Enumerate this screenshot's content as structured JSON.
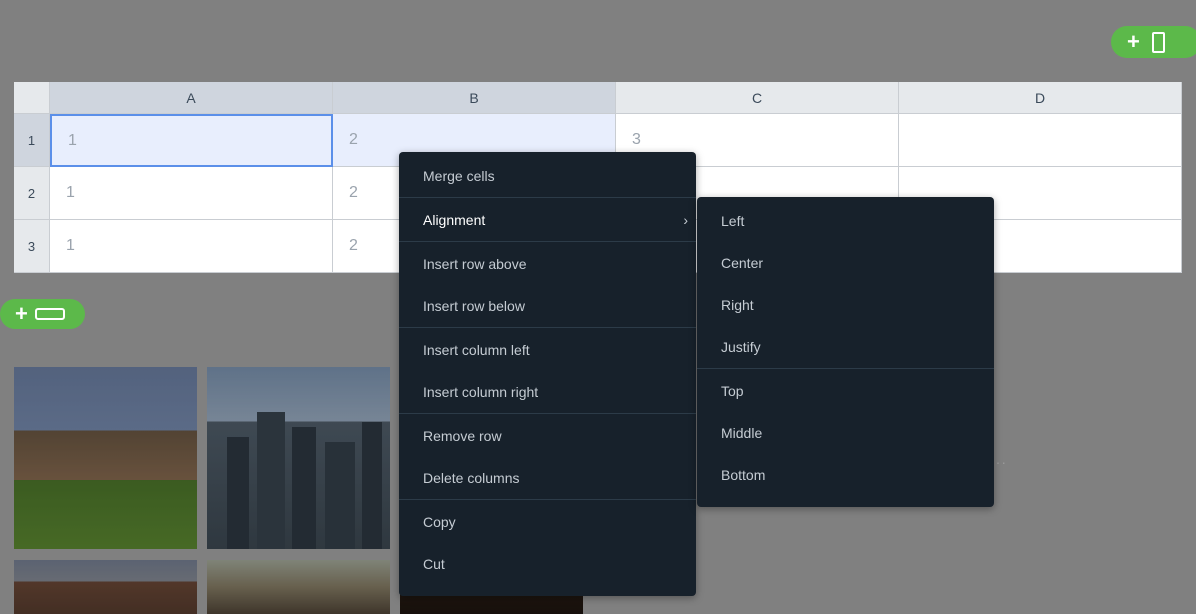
{
  "toolbar": {
    "add_column_plus": "+",
    "add_row_plus": "+"
  },
  "sheet": {
    "columns": [
      "A",
      "B",
      "C",
      "D"
    ],
    "rows": [
      "1",
      "2",
      "3"
    ],
    "cells": [
      [
        "1",
        "2",
        "3",
        ""
      ],
      [
        "1",
        "2",
        "",
        ""
      ],
      [
        "1",
        "2",
        "",
        ""
      ]
    ]
  },
  "context_menu": {
    "items": [
      "Merge cells",
      "Alignment",
      "Insert row above",
      "Insert row below",
      "Insert column left",
      "Insert column right",
      "Remove row",
      "Delete columns",
      "Copy",
      "Cut"
    ],
    "submenu_chevron": "›"
  },
  "alignment_submenu": {
    "items": [
      "Left",
      "Center",
      "Right",
      "Justify",
      "Top",
      "Middle",
      "Bottom"
    ]
  },
  "colors": {
    "accent_green": "#5cb94a",
    "menu_bg": "#17212b",
    "selection_border": "#5b8fe9",
    "selection_fill": "#e8eefd"
  }
}
